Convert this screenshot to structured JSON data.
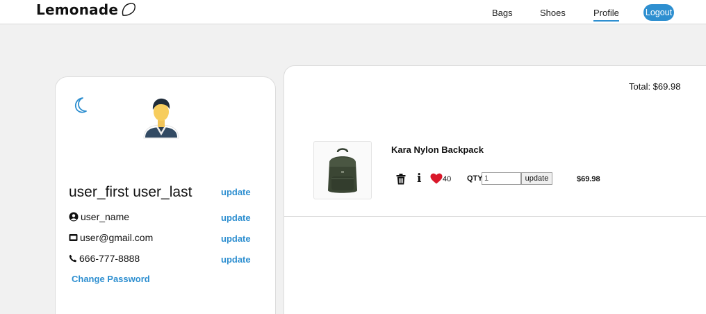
{
  "nav": {
    "brand": "Lemonade",
    "links": {
      "bags": "Bags",
      "shoes": "Shoes",
      "profile": "Profile"
    },
    "logout": "Logout",
    "active": "Profile",
    "accent_color": "#2e8fd0"
  },
  "profile": {
    "full_name": "user_first user_last",
    "username": "user_name",
    "email": "user@gmail.com",
    "phone": "666-777-8888",
    "update_label": "update",
    "change_password": "Change Password",
    "icons": [
      "moon-icon",
      "avatar",
      "user-circle-icon",
      "envelope-icon",
      "phone-icon"
    ]
  },
  "cart": {
    "total": "Total: $69.98",
    "items": [
      {
        "name": "Kara Nylon Backpack",
        "likes": "40",
        "qty_label": "QTY",
        "qty_value": "1",
        "update_label": "update",
        "price": "$69.98",
        "icons": [
          "trash-icon",
          "info-icon",
          "heart-icon"
        ]
      }
    ]
  }
}
